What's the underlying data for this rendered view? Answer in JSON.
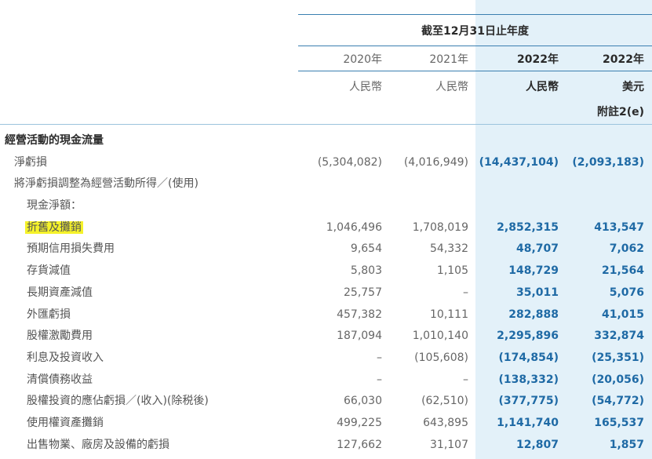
{
  "header": {
    "period_title": "截至12月31日止年度",
    "years": [
      "2020年",
      "2021年",
      "2022年",
      "2022年"
    ],
    "currencies": [
      "人民幣",
      "人民幣",
      "人民幣",
      "美元"
    ],
    "note": "附註2(e)"
  },
  "rows": [
    {
      "label": "經營活動的現金流量",
      "level": 0,
      "values": [
        "",
        "",
        "",
        ""
      ]
    },
    {
      "label": "淨虧損",
      "level": 1,
      "values": [
        "(5,304,082)",
        "(4,016,949)",
        "(14,437,104)",
        "(2,093,183)"
      ]
    },
    {
      "label": "將淨虧損調整為經營活動所得／(使用)",
      "level": 1,
      "values": [
        "",
        "",
        "",
        ""
      ]
    },
    {
      "label": "現金淨額：",
      "level": 2,
      "values": [
        "",
        "",
        "",
        ""
      ]
    },
    {
      "label": "折舊及攤銷",
      "level": 2,
      "highlight": true,
      "values": [
        "1,046,496",
        "1,708,019",
        "2,852,315",
        "413,547"
      ]
    },
    {
      "label": "預期信用損失費用",
      "level": 2,
      "values": [
        "9,654",
        "54,332",
        "48,707",
        "7,062"
      ]
    },
    {
      "label": "存貨減值",
      "level": 2,
      "values": [
        "5,803",
        "1,105",
        "148,729",
        "21,564"
      ]
    },
    {
      "label": "長期資產減值",
      "level": 2,
      "values": [
        "25,757",
        "–",
        "35,011",
        "5,076"
      ]
    },
    {
      "label": "外匯虧損",
      "level": 2,
      "values": [
        "457,382",
        "10,111",
        "282,888",
        "41,015"
      ]
    },
    {
      "label": "股權激勵費用",
      "level": 2,
      "values": [
        "187,094",
        "1,010,140",
        "2,295,896",
        "332,874"
      ]
    },
    {
      "label": "利息及投資收入",
      "level": 2,
      "values": [
        "–",
        "(105,608)",
        "(174,854)",
        "(25,351)"
      ]
    },
    {
      "label": "清償債務收益",
      "level": 2,
      "values": [
        "–",
        "–",
        "(138,332)",
        "(20,056)"
      ]
    },
    {
      "label": "股權投資的應佔虧損／(收入)(除税後)",
      "level": 2,
      "values": [
        "66,030",
        "(62,510)",
        "(377,775)",
        "(54,772)"
      ]
    },
    {
      "label": "使用權資產攤銷",
      "level": 2,
      "values": [
        "499,225",
        "643,895",
        "1,141,740",
        "165,537"
      ]
    },
    {
      "label": "出售物業、廠房及設備的虧損",
      "level": 2,
      "values": [
        "127,662",
        "31,107",
        "12,807",
        "1,857"
      ]
    }
  ]
}
